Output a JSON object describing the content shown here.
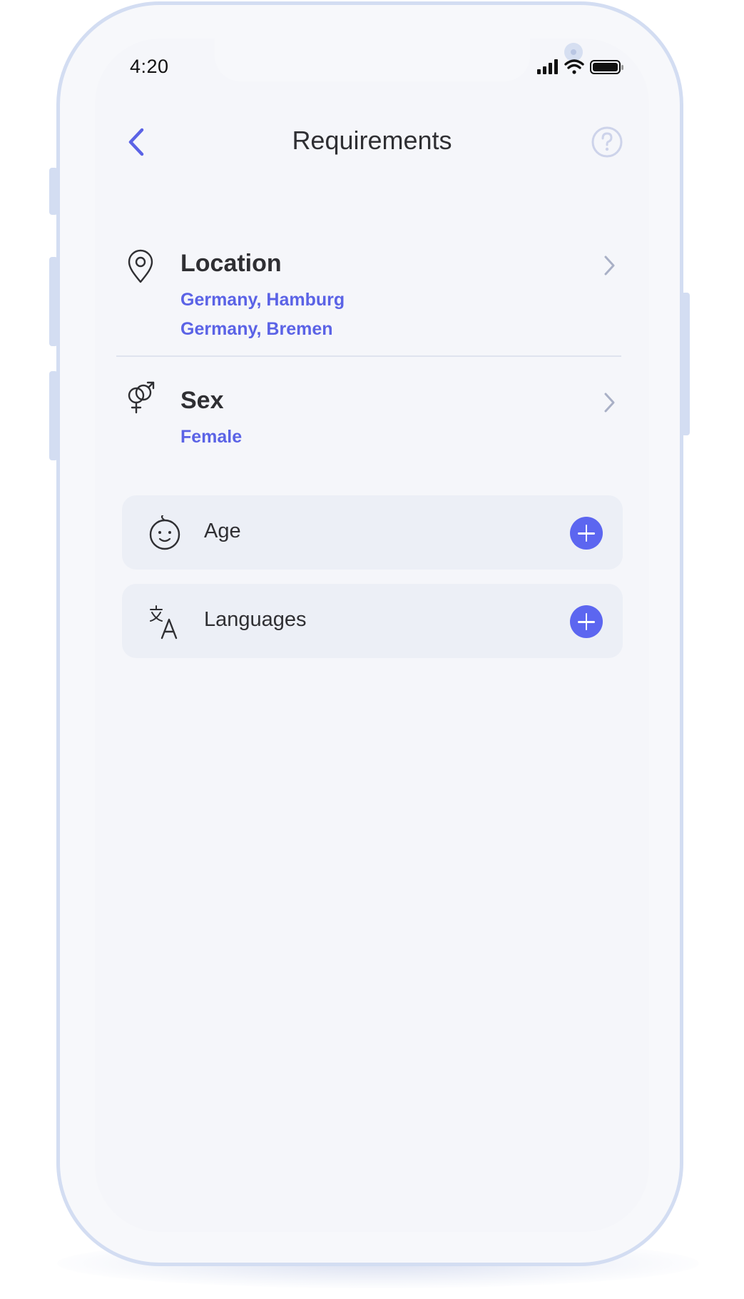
{
  "status_bar": {
    "time": "4:20",
    "icons": [
      "cellular-signal-icon",
      "wifi-icon",
      "battery-icon"
    ]
  },
  "nav": {
    "title": "Requirements",
    "back_icon": "chevron-left-icon",
    "help_icon": "question-circle-icon"
  },
  "requirements": [
    {
      "label": "Location",
      "icon": "map-pin-icon",
      "values": [
        "Germany, Hamburg",
        "Germany, Bremen"
      ]
    },
    {
      "label": "Sex",
      "icon": "gender-symbols-icon",
      "values": [
        "Female"
      ]
    }
  ],
  "optional_requirements": [
    {
      "label": "Age",
      "icon": "baby-face-icon",
      "action_icon": "plus-icon"
    },
    {
      "label": "Languages",
      "icon": "translate-icon",
      "action_icon": "plus-icon"
    }
  ],
  "colors": {
    "accent": "#5b63e6",
    "add_button": "#5c66f0",
    "title_text": "#2f2f33",
    "card_background": "#eceff6",
    "screen_background": "#f5f6fa",
    "frame": "#d3ddf2"
  }
}
